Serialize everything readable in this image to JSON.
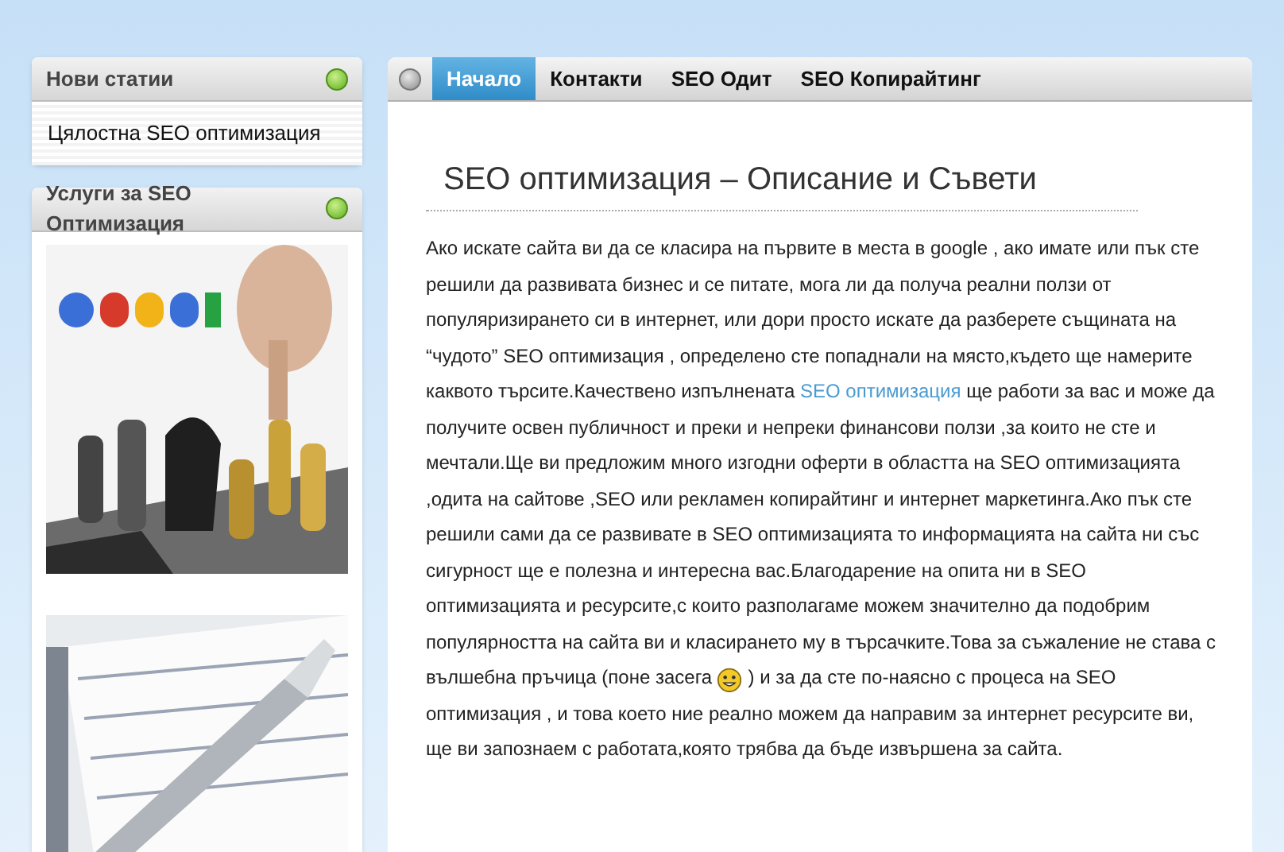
{
  "sidebar": {
    "panels": [
      {
        "title": "Нови статии",
        "kind": "links",
        "items": [
          "Цялостна SEO оптимизация"
        ]
      },
      {
        "title": "Услуги за SEO Оптимизация",
        "kind": "pictures"
      }
    ]
  },
  "nav": {
    "tabs": [
      {
        "label": "Начало",
        "selected": true
      },
      {
        "label": "Контакти",
        "selected": false
      },
      {
        "label": "SEO Одит",
        "selected": false
      },
      {
        "label": "SEO Копирайтинг",
        "selected": false
      }
    ]
  },
  "article": {
    "title": "SEO оптимизация – Описание и Съвети",
    "paragraph": [
      {
        "kind": "text",
        "text": "Ако искате сайта ви да се класира на първите в места в google , ако имате или пък сте решили да развивата бизнес и се питате, мога ли да получа реални ползи от популяризирането си в интернет, или дори просто искате да разберете същината на “чудото” SEO оптимизация , определено сте попаднали на място,където ще намерите каквото търсите.Качествено изпълнената "
      },
      {
        "kind": "link",
        "text": "SEO оптимизация"
      },
      {
        "kind": "text",
        "text": " ще работи за вас и може да получите освен публичност и преки и непреки финансови ползи ,за които не сте и мечтали.Ще ви предложим много изгодни оферти в областта на SEO оптимизацията ,одита на сайтове ,SEO или рекламен копирайтинг и интернет маркетинга.Ако пък сте решили сами да се развивате в SEO оптимизацията то информацията на сайта ни със сигурност ще е полезна и интересна вас.Благодарение на опита ни в SEO оптимизацията и ресурсите,с които разполагаме можем значително да подобрим популярността на сайта ви и класирането му в търсачките.Това за съжаление не става с вълшебна пръчица (поне засега "
      },
      {
        "kind": "smiley"
      },
      {
        "kind": "text",
        "text": " ) и за да сте по-наясно с процеса на SEO оптимизация , и това което ние реално можем да направим за интернет ресурсите ви, ще ви запознаем с работата,която трябва да бъде извършена за сайта."
      }
    ]
  }
}
